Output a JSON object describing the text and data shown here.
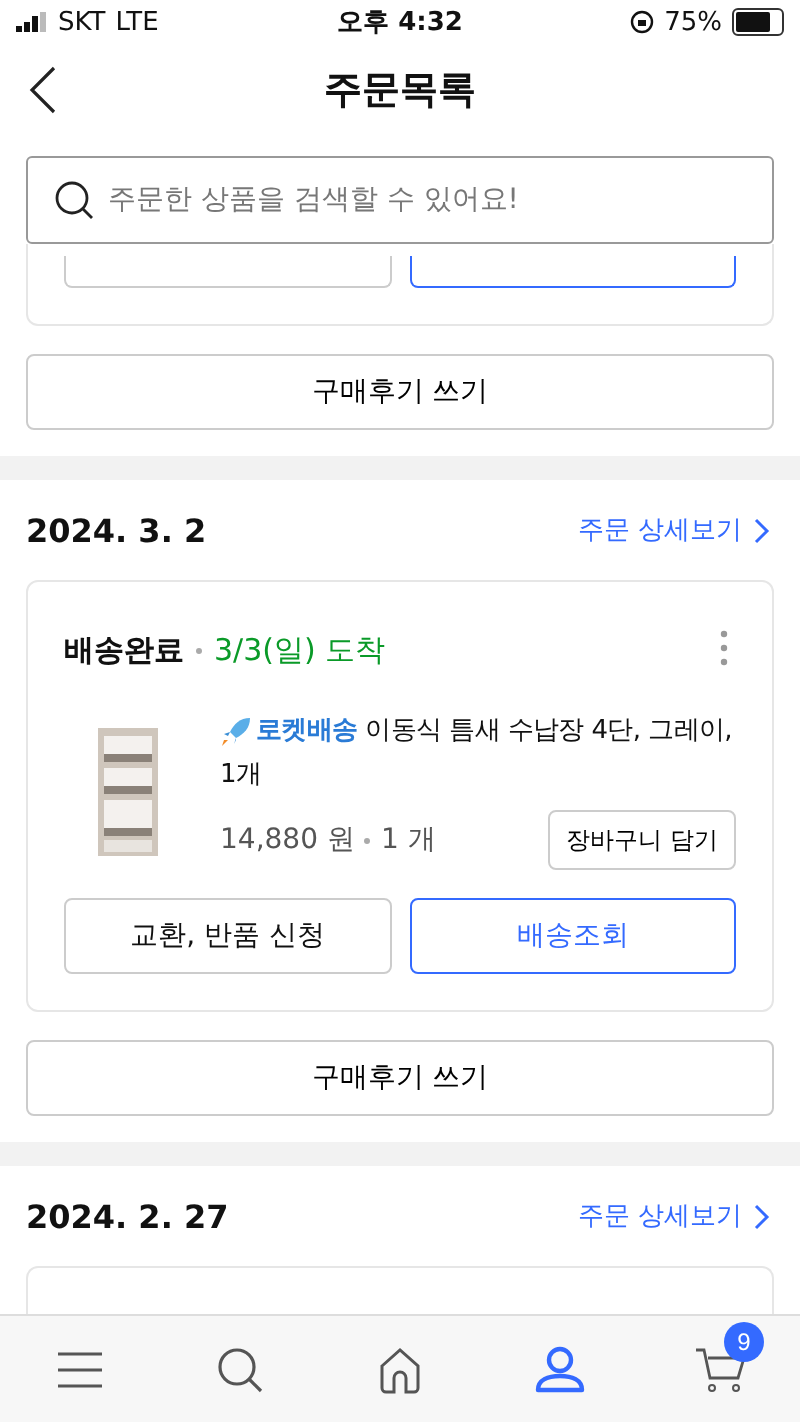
{
  "status_bar": {
    "carrier": "SKT",
    "network": "LTE",
    "time": "오후 4:32",
    "battery": "75%"
  },
  "header": {
    "title": "주문목록"
  },
  "search": {
    "placeholder": "주문한 상품을 검색할 수 있어요!"
  },
  "orders": [
    {
      "kind": "tail",
      "review_button": "구매후기 쓰기"
    },
    {
      "kind": "full",
      "date": "2024. 3. 2",
      "detail_link": "주문 상세보기",
      "status": "배송완료",
      "arrival": "3/3(일) 도착",
      "product": "**로켓배송** 이동식 틈새 수납장 4단, 그레이, 1개",
      "price": "14,880 원",
      "quantity": "1 개",
      "cart_button": "장바구니 담기",
      "actions": [
        {
          "label": "교환, 반품 신청",
          "primary": false
        },
        {
          "label": "배송조회",
          "primary": true
        }
      ],
      "review_button": "구매후기 쓰기"
    },
    {
      "kind": "head",
      "date": "2024. 2. 27",
      "detail_link": "주문 상세보기"
    }
  ],
  "tab_bar": [
    {
      "kind": "menu",
      "selected": false
    },
    {
      "kind": "search",
      "selected": false
    },
    {
      "kind": "home",
      "selected": false
    },
    {
      "kind": "account",
      "selected": true
    },
    {
      "kind": "cart",
      "selected": false,
      "badge": "9"
    }
  ]
}
